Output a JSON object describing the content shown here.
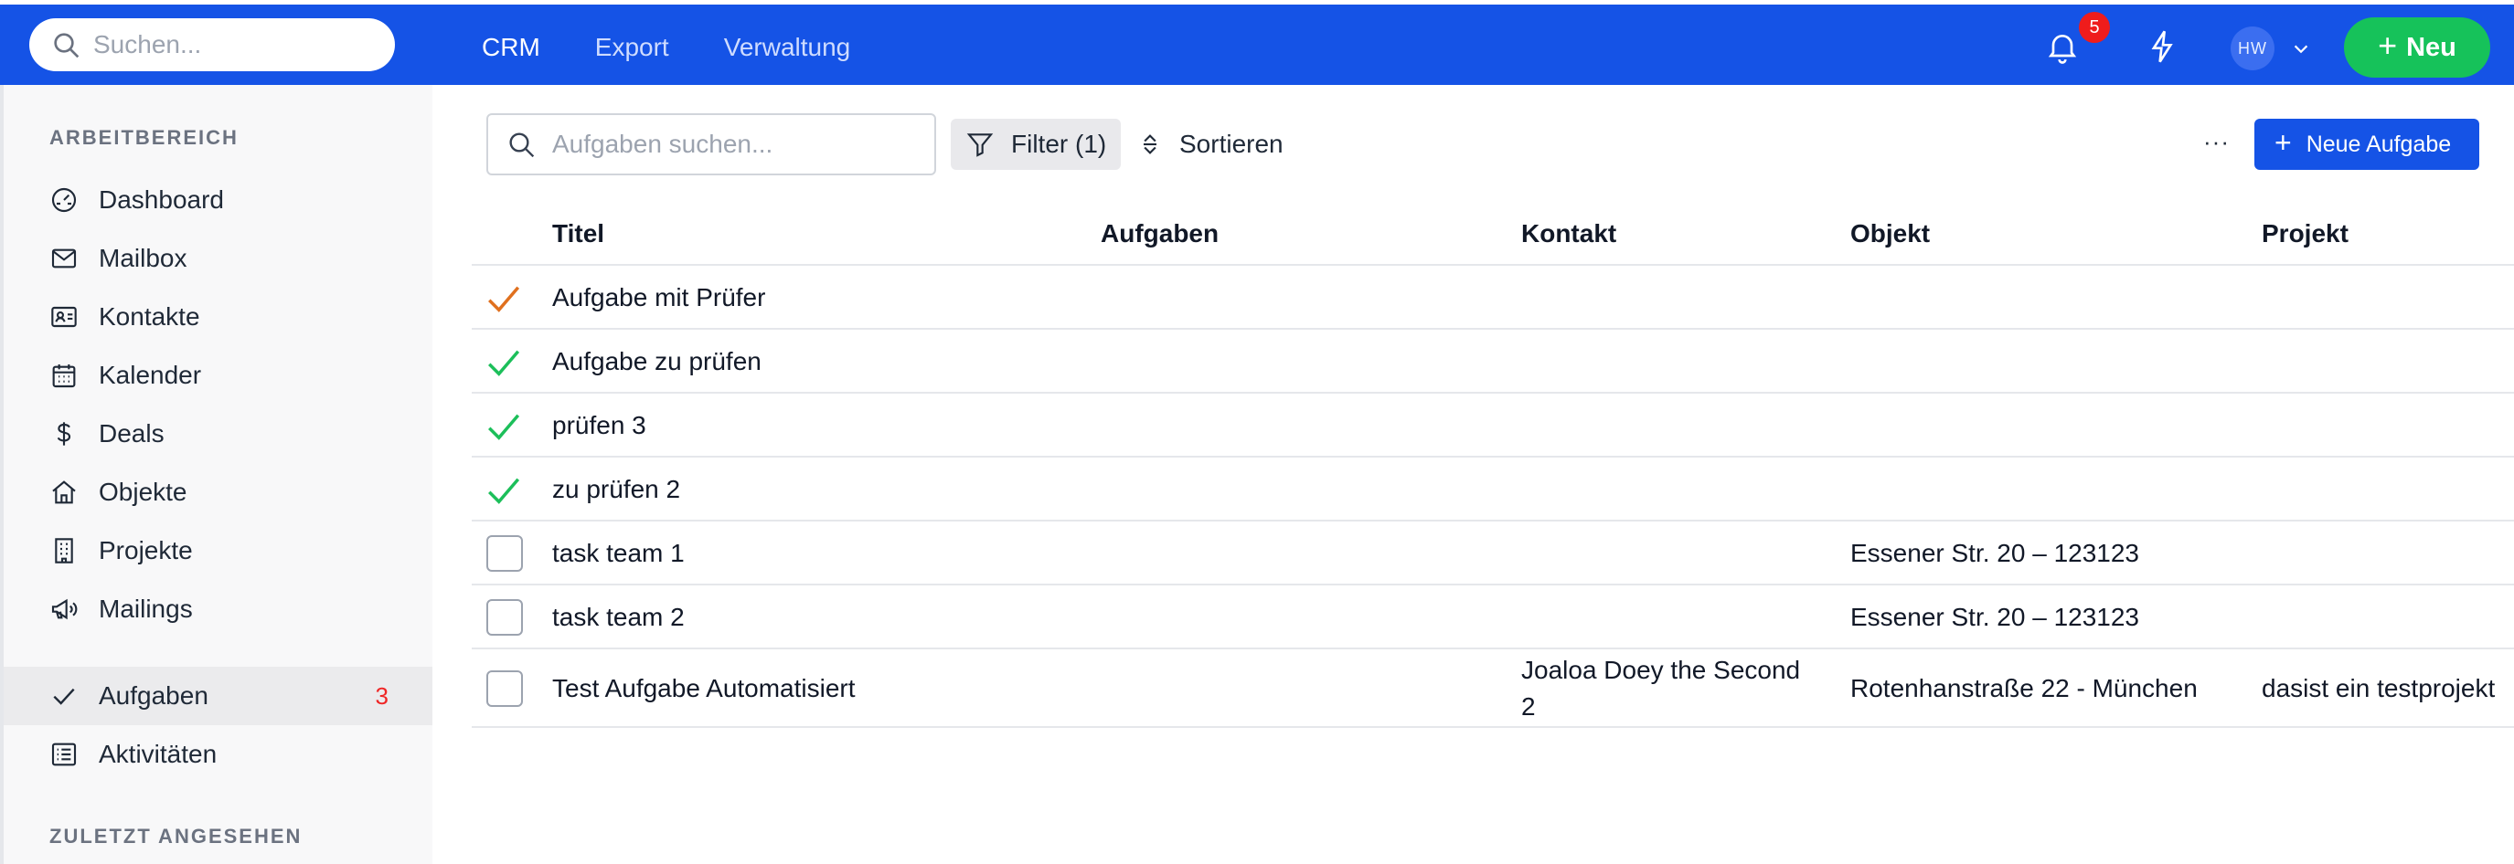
{
  "topbar": {
    "search_placeholder": "Suchen...",
    "nav": [
      "CRM",
      "Export",
      "Verwaltung"
    ],
    "notification_count": "5",
    "avatar_initials": "HW",
    "new_button": "Neu",
    "colors": {
      "bar": "#1553e6",
      "new_button": "#16c25a",
      "badge": "#ef1c1c"
    }
  },
  "sidebar": {
    "section_workspace": "ARBEITBEREICH",
    "items": [
      {
        "label": "Dashboard",
        "icon": "gauge-icon"
      },
      {
        "label": "Mailbox",
        "icon": "envelope-icon"
      },
      {
        "label": "Kontakte",
        "icon": "contact-card-icon"
      },
      {
        "label": "Kalender",
        "icon": "calendar-icon"
      },
      {
        "label": "Deals",
        "icon": "dollar-icon"
      },
      {
        "label": "Objekte",
        "icon": "home-icon"
      },
      {
        "label": "Projekte",
        "icon": "building-icon"
      },
      {
        "label": "Mailings",
        "icon": "megaphone-icon"
      }
    ],
    "active_item": {
      "label": "Aufgaben",
      "count": "3",
      "icon": "check-icon"
    },
    "activities": {
      "label": "Aktivitäten",
      "icon": "list-icon"
    },
    "section_recent": "ZULETZT ANGESEHEN"
  },
  "toolbar": {
    "search_placeholder": "Aufgaben suchen...",
    "filter_label": "Filter (1)",
    "sort_label": "Sortieren",
    "more_label": "···",
    "new_task_label": "Neue Aufgabe"
  },
  "table": {
    "columns": [
      "Titel",
      "Aufgaben",
      "Kontakt",
      "Objekt",
      "Projekt"
    ],
    "rows": [
      {
        "status": "review",
        "title": "Aufgabe mit Prüfer",
        "aufgaben": "",
        "kontakt": "",
        "objekt": "",
        "projekt": ""
      },
      {
        "status": "done",
        "title": "Aufgabe zu prüfen",
        "aufgaben": "",
        "kontakt": "",
        "objekt": "",
        "projekt": ""
      },
      {
        "status": "done",
        "title": "prüfen 3",
        "aufgaben": "",
        "kontakt": "",
        "objekt": "",
        "projekt": ""
      },
      {
        "status": "done",
        "title": "zu prüfen 2",
        "aufgaben": "",
        "kontakt": "",
        "objekt": "",
        "projekt": ""
      },
      {
        "status": "open",
        "title": "task team 1",
        "aufgaben": "",
        "kontakt": "",
        "objekt": "Essener Str. 20 – 123123",
        "projekt": ""
      },
      {
        "status": "open",
        "title": "task team 2",
        "aufgaben": "",
        "kontakt": "",
        "objekt": "Essener Str. 20 – 123123",
        "projekt": ""
      },
      {
        "status": "open",
        "title": "Test Aufgabe Automatisiert",
        "aufgaben": "",
        "kontakt_line1": "Joaloa Doey the Second",
        "kontakt_line2": "2",
        "objekt": "Rotenhanstraße 22 - München",
        "projekt": "dasist ein testprojekt"
      }
    ],
    "status_colors": {
      "review": "#e0701e",
      "done": "#1cbf5a"
    }
  }
}
